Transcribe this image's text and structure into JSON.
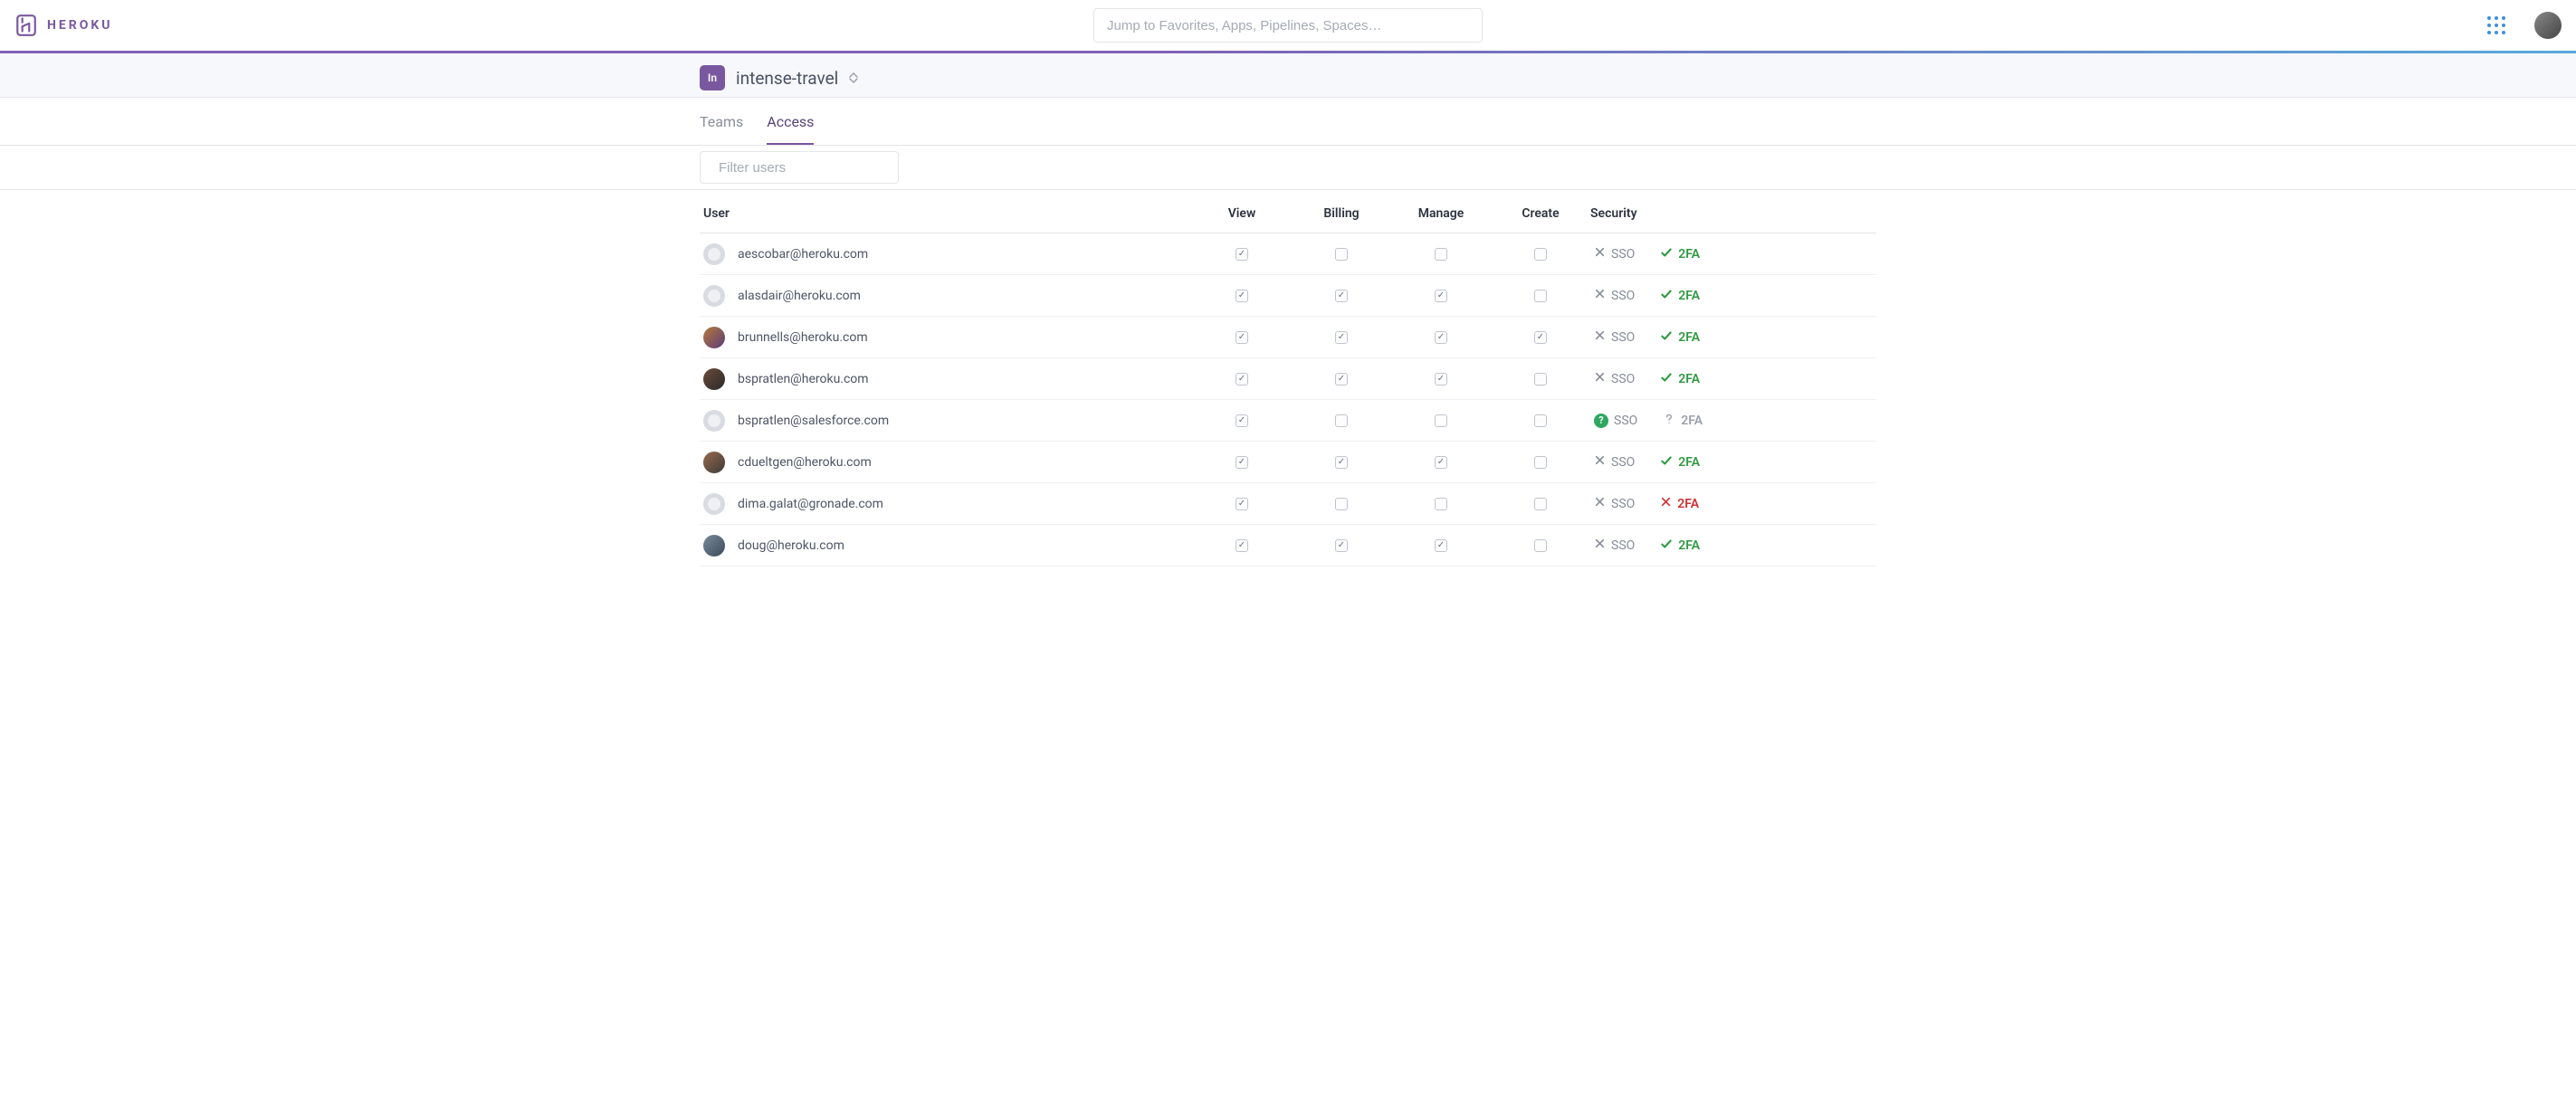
{
  "brand": {
    "name": "HEROKU"
  },
  "search": {
    "placeholder": "Jump to Favorites, Apps, Pipelines, Spaces…"
  },
  "context": {
    "badge": "In",
    "name": "intense-travel"
  },
  "tabs": [
    {
      "id": "teams",
      "label": "Teams",
      "active": false
    },
    {
      "id": "access",
      "label": "Access",
      "active": true
    }
  ],
  "filter": {
    "placeholder": "Filter users"
  },
  "columns": {
    "user": "User",
    "view": "View",
    "billing": "Billing",
    "manage": "Manage",
    "create": "Create",
    "security": "Security"
  },
  "badges": {
    "sso": "SSO",
    "tfa": "2FA"
  },
  "users": [
    {
      "email": "aescobar@heroku.com",
      "avatar": "gray",
      "perm": {
        "view": true,
        "billing": false,
        "manage": false,
        "create": false
      },
      "sec": {
        "sso": "off",
        "tfa": "on"
      }
    },
    {
      "email": "alasdair@heroku.com",
      "avatar": "gray",
      "perm": {
        "view": true,
        "billing": true,
        "manage": true,
        "create": false
      },
      "sec": {
        "sso": "off",
        "tfa": "on"
      }
    },
    {
      "email": "brunnells@heroku.com",
      "avatar": "photo1",
      "perm": {
        "view": true,
        "billing": true,
        "manage": true,
        "create": true
      },
      "sec": {
        "sso": "off",
        "tfa": "on"
      }
    },
    {
      "email": "bspratlen@heroku.com",
      "avatar": "photo2",
      "perm": {
        "view": true,
        "billing": true,
        "manage": true,
        "create": false
      },
      "sec": {
        "sso": "off",
        "tfa": "on"
      }
    },
    {
      "email": "bspratlen@salesforce.com",
      "avatar": "gray",
      "perm": {
        "view": true,
        "billing": false,
        "manage": false,
        "create": false
      },
      "sec": {
        "sso": "on",
        "tfa": "unk"
      }
    },
    {
      "email": "cdueltgen@heroku.com",
      "avatar": "photo3",
      "perm": {
        "view": true,
        "billing": true,
        "manage": true,
        "create": false
      },
      "sec": {
        "sso": "off",
        "tfa": "on"
      }
    },
    {
      "email": "dima.galat@gronade.com",
      "avatar": "gray",
      "perm": {
        "view": true,
        "billing": false,
        "manage": false,
        "create": false
      },
      "sec": {
        "sso": "off",
        "tfa": "off"
      }
    },
    {
      "email": "doug@heroku.com",
      "avatar": "photo4",
      "perm": {
        "view": true,
        "billing": true,
        "manage": true,
        "create": false
      },
      "sec": {
        "sso": "off",
        "tfa": "on"
      }
    }
  ]
}
